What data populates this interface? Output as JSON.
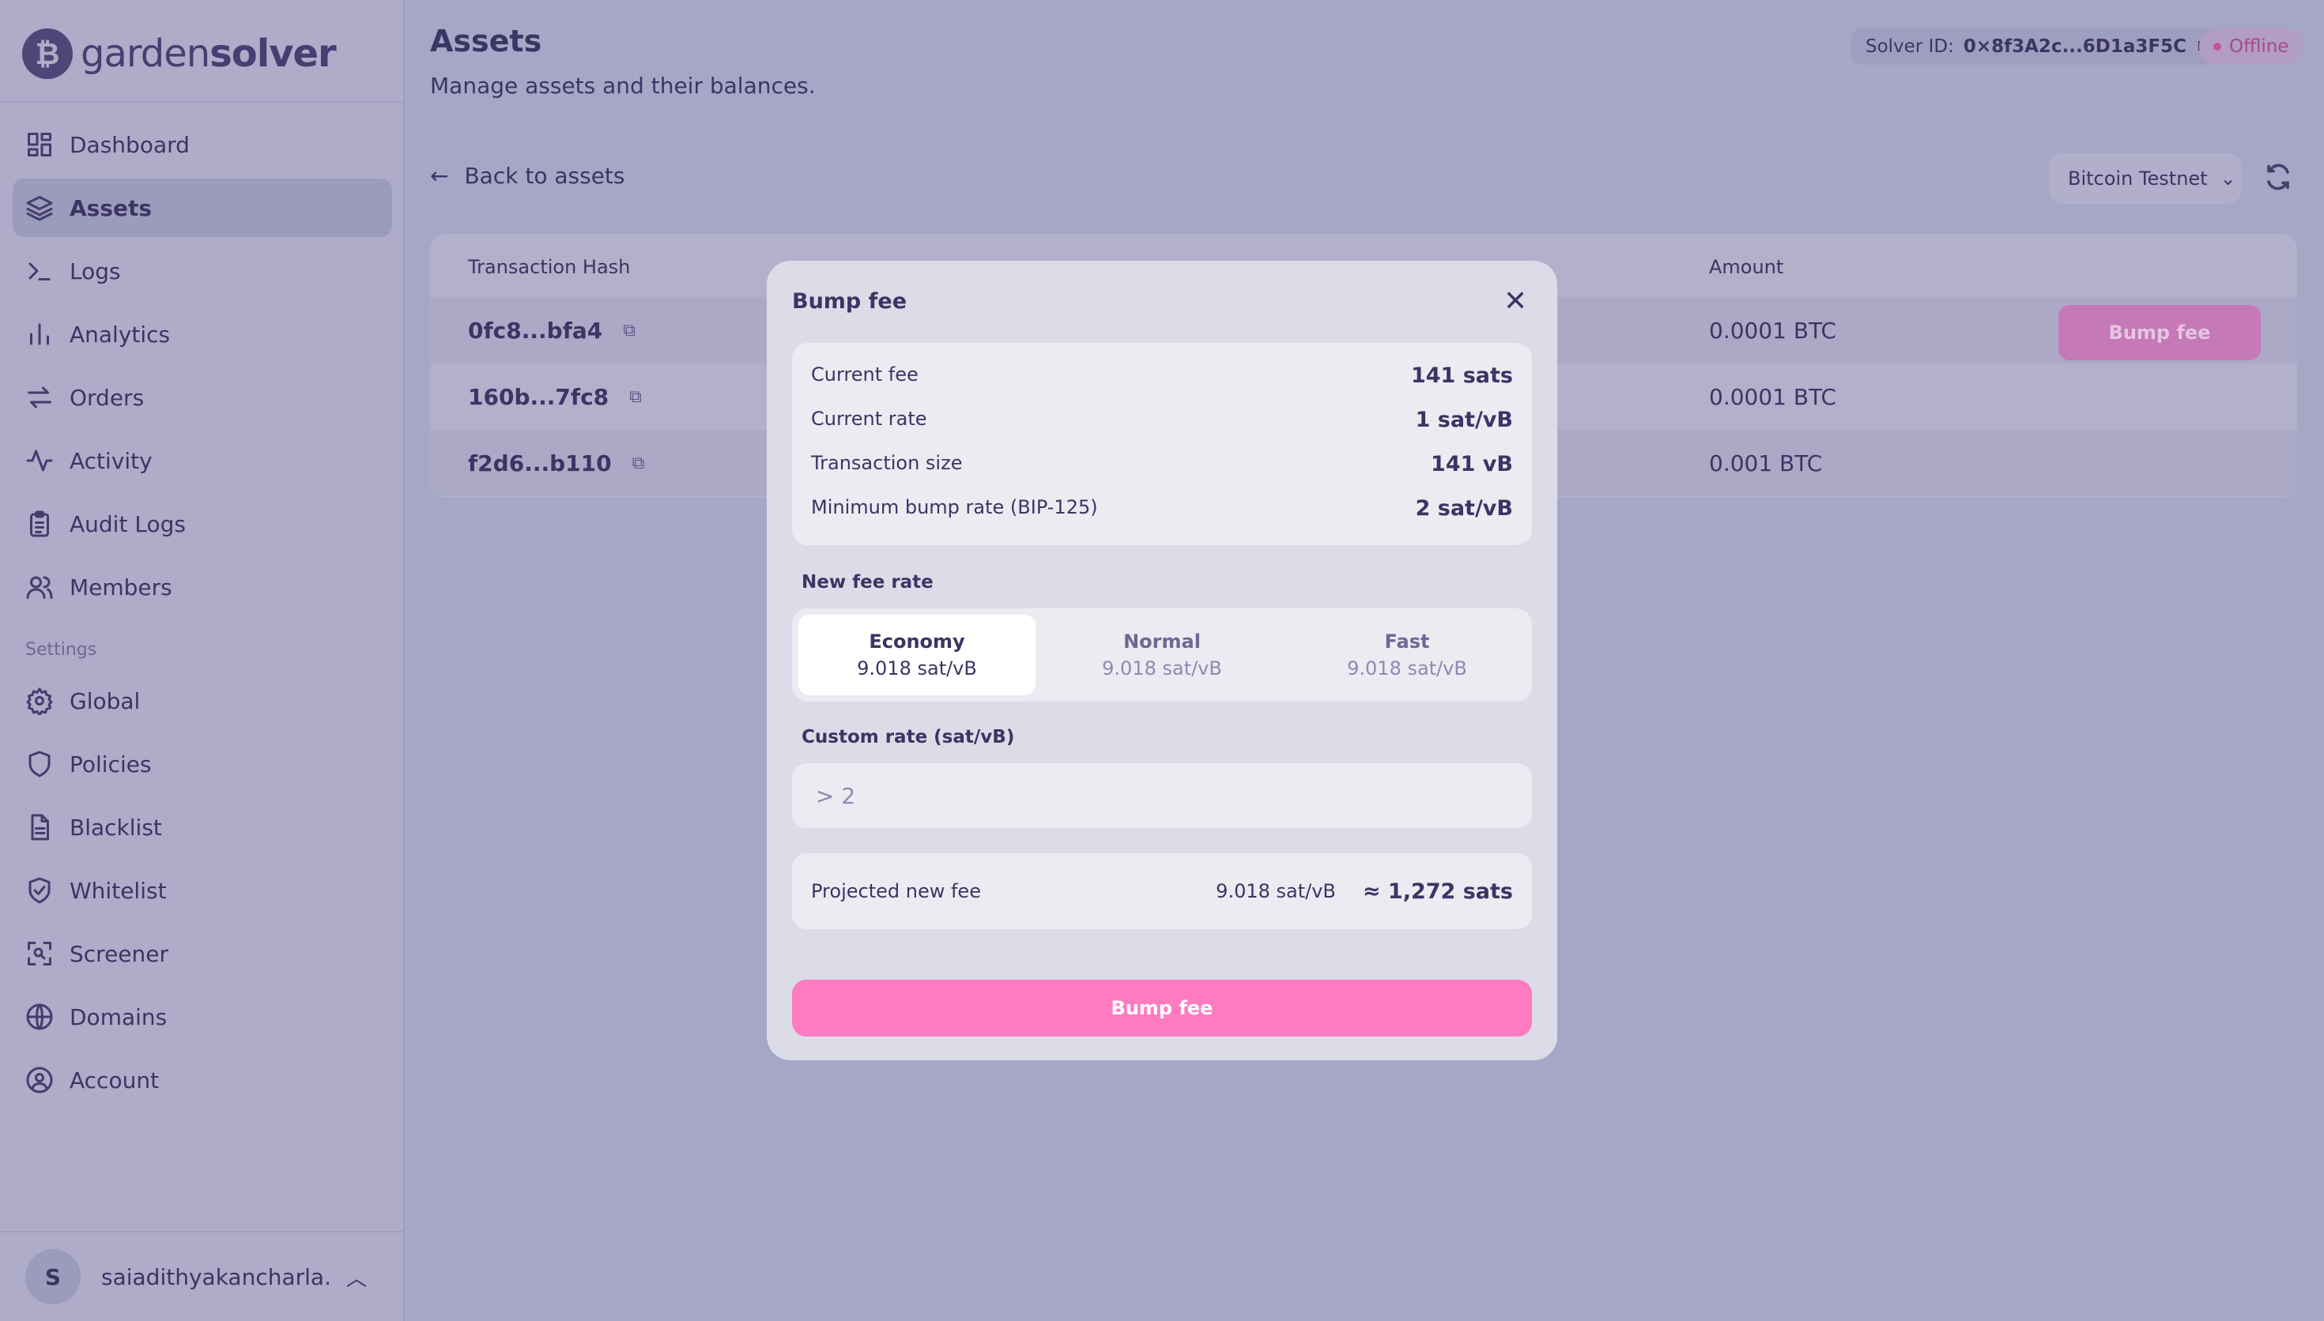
{
  "brand": {
    "logo_glyph": "₿",
    "name_light": "garden",
    "name_bold": "solver"
  },
  "sidebar": {
    "items": [
      {
        "label": "Dashboard",
        "icon": "dashboard-icon"
      },
      {
        "label": "Assets",
        "icon": "layers-icon",
        "active": true
      },
      {
        "label": "Logs",
        "icon": "terminal-icon"
      },
      {
        "label": "Analytics",
        "icon": "bar-chart-icon"
      },
      {
        "label": "Orders",
        "icon": "swap-icon"
      },
      {
        "label": "Activity",
        "icon": "activity-icon"
      },
      {
        "label": "Audit Logs",
        "icon": "clipboard-icon"
      },
      {
        "label": "Members",
        "icon": "users-icon"
      }
    ],
    "settings_label": "Settings",
    "settings_items": [
      {
        "label": "Global",
        "icon": "gear-icon"
      },
      {
        "label": "Policies",
        "icon": "shield-icon"
      },
      {
        "label": "Blacklist",
        "icon": "document-icon"
      },
      {
        "label": "Whitelist",
        "icon": "shield-check-icon"
      },
      {
        "label": "Screener",
        "icon": "scan-icon"
      },
      {
        "label": "Domains",
        "icon": "globe-icon"
      },
      {
        "label": "Account",
        "icon": "user-circle-icon"
      }
    ],
    "user": {
      "initial": "S",
      "name": "saiadithyakancharla..."
    }
  },
  "header": {
    "title": "Assets",
    "subtitle": "Manage assets and their balances.",
    "solver_id_label": "Solver ID:",
    "solver_id_value": "0×8f3A2c...6D1a3F5C",
    "status": "Offline"
  },
  "toolbar": {
    "back_label": "Back to assets",
    "network": "Bitcoin Testnet"
  },
  "table": {
    "columns": {
      "hash": "Transaction Hash",
      "amount": "Amount"
    },
    "rows": [
      {
        "hash": "0fc8...bfa4",
        "amount": "0.0001 BTC",
        "action": "Bump fee"
      },
      {
        "hash": "160b...7fc8",
        "amount": "0.0001 BTC"
      },
      {
        "hash": "f2d6...b110",
        "amount": "0.001 BTC"
      }
    ]
  },
  "modal": {
    "title": "Bump fee",
    "info": [
      {
        "label": "Current fee",
        "value": "141 sats"
      },
      {
        "label": "Current rate",
        "value": "1 sat/vB"
      },
      {
        "label": "Transaction size",
        "value": "141 vB"
      },
      {
        "label": "Minimum bump rate (BIP-125)",
        "value": "2 sat/vB"
      }
    ],
    "new_fee_rate_label": "New fee rate",
    "rates": [
      {
        "name": "Economy",
        "value": "9.018 sat/vB",
        "selected": true
      },
      {
        "name": "Normal",
        "value": "9.018 sat/vB"
      },
      {
        "name": "Fast",
        "value": "9.018 sat/vB"
      }
    ],
    "custom_rate_label": "Custom rate (sat/vB)",
    "custom_rate_placeholder": "> 2",
    "projected_label": "Projected new fee",
    "projected_rate": "9.018 sat/vB",
    "projected_fee": "≈ 1,272 sats",
    "submit_label": "Bump fee"
  },
  "colors": {
    "accent": "#ff7bc0",
    "text": "#3b3564",
    "overlay": "#a6a6c7"
  }
}
